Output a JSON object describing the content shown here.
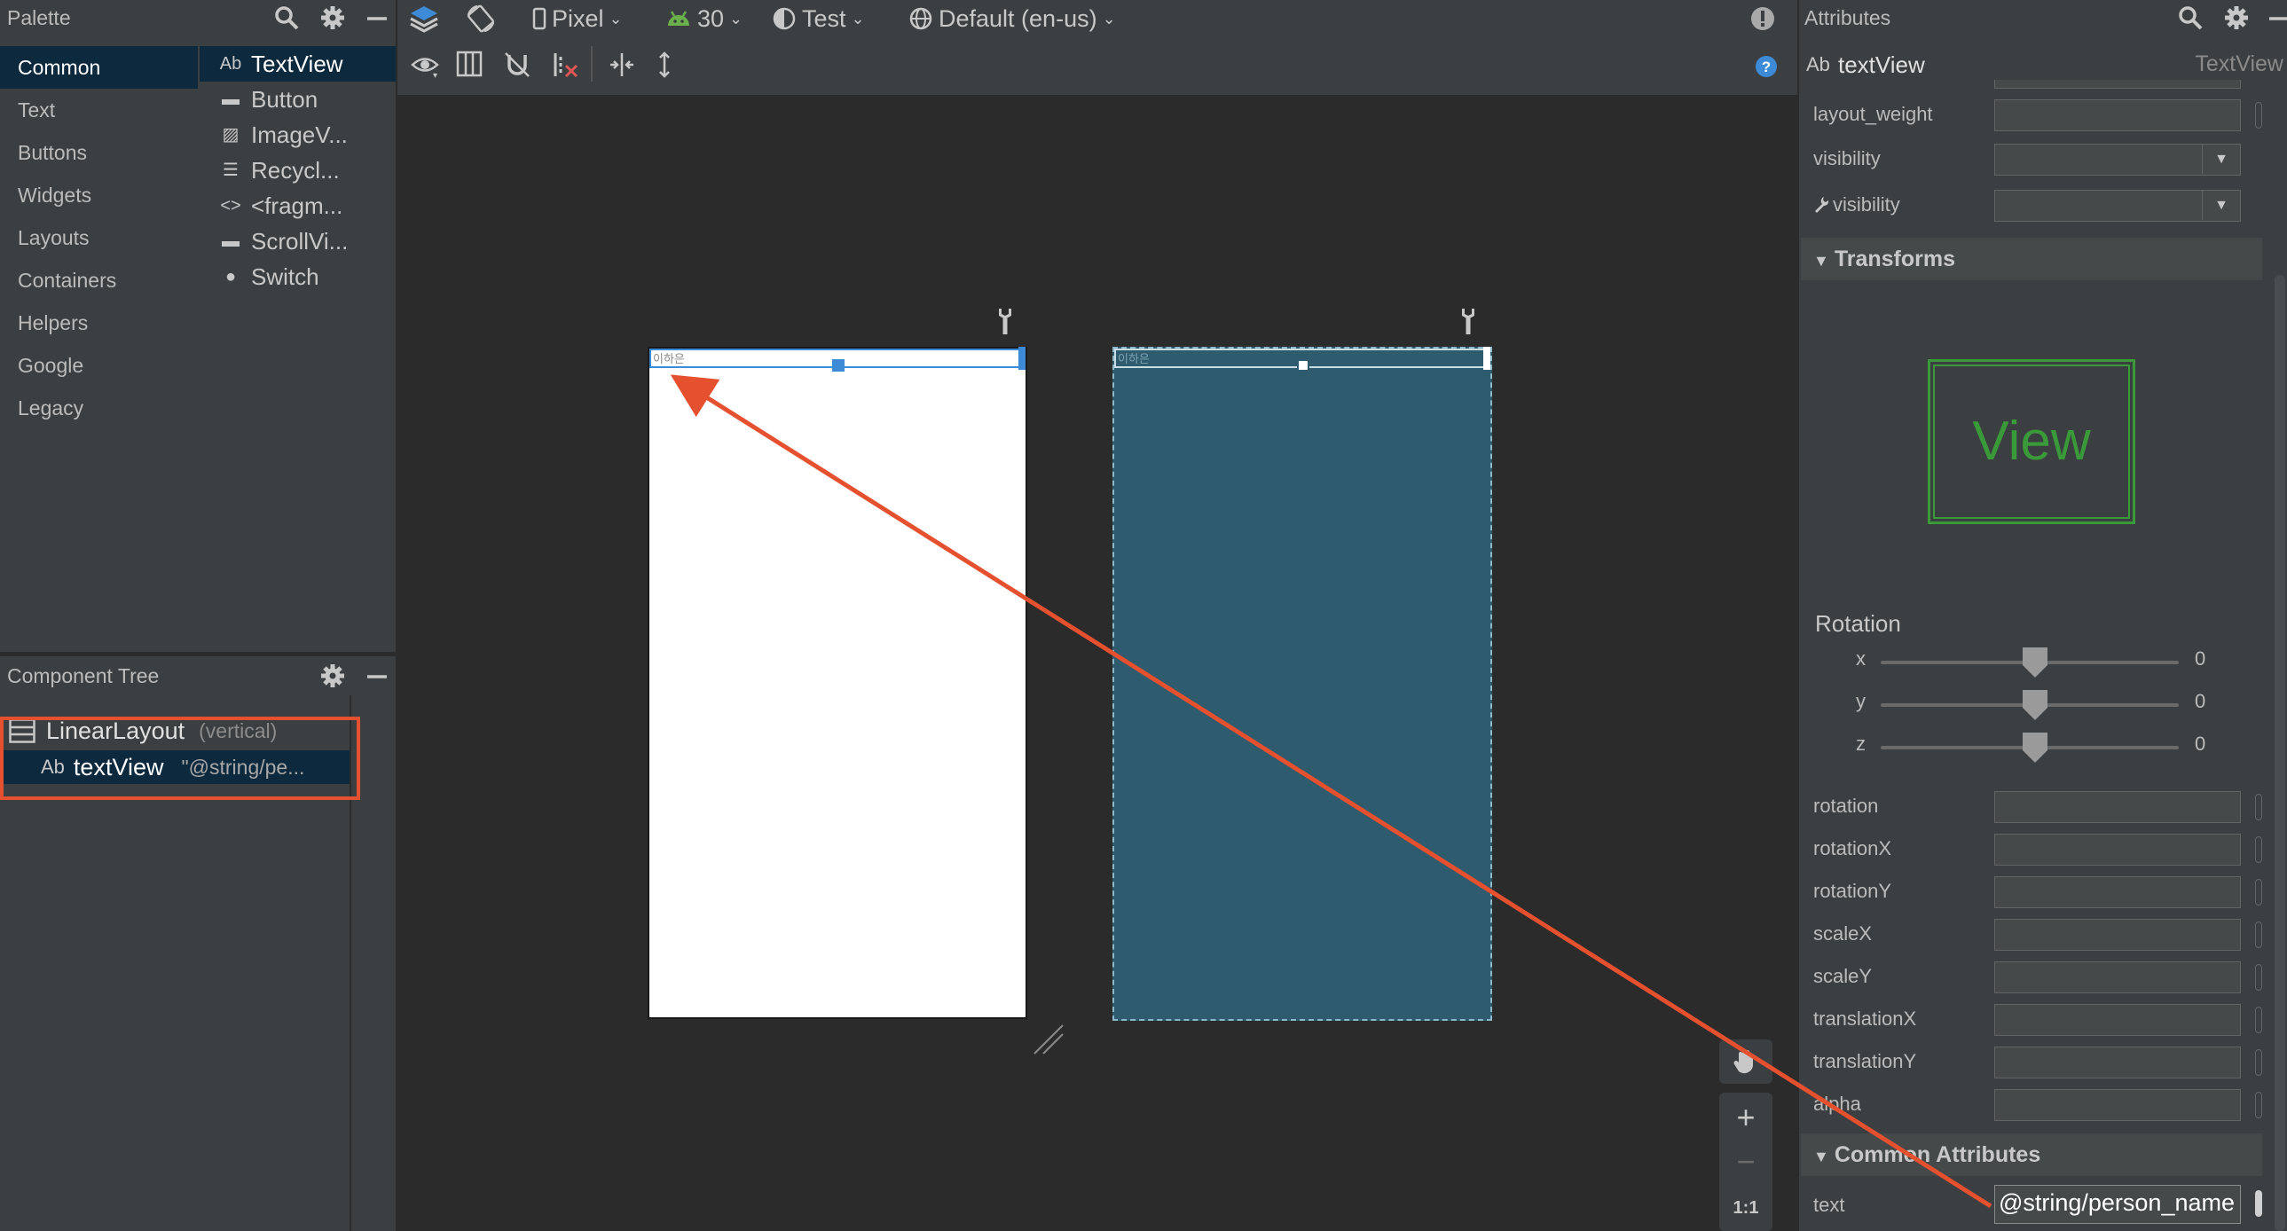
{
  "palette": {
    "title": "Palette",
    "categories": [
      "Common",
      "Text",
      "Buttons",
      "Widgets",
      "Layouts",
      "Containers",
      "Helpers",
      "Google",
      "Legacy"
    ],
    "items": [
      {
        "icon": "Ab",
        "label": "TextView"
      },
      {
        "icon": "▬",
        "label": "Button"
      },
      {
        "icon": "▨",
        "label": "ImageV..."
      },
      {
        "icon": "☰",
        "label": "Recycl..."
      },
      {
        "icon": "<>",
        "label": "<fragm..."
      },
      {
        "icon": "▬",
        "label": "ScrollVi..."
      },
      {
        "icon": "●",
        "label": "Switch"
      }
    ]
  },
  "component_tree": {
    "title": "Component Tree",
    "root": {
      "label": "LinearLayout",
      "hint": "(vertical)"
    },
    "child": {
      "prefix": "Ab",
      "label": "textView",
      "hint": "\"@string/pe..."
    }
  },
  "toolbar": {
    "device": "Pixel",
    "api": "30",
    "theme": "Test",
    "locale": "Default (en-us)"
  },
  "canvas": {
    "design_text": "이하은",
    "blueprint_text": "이하은",
    "zoom_reset": "1:1"
  },
  "attributes": {
    "title": "Attributes",
    "component_prefix": "Ab",
    "component_name": "textView",
    "component_type": "TextView",
    "rows_top": [
      "layout_weight",
      "visibility",
      "visibility"
    ],
    "transforms_title": "Transforms",
    "preview_text": "View",
    "rotation_title": "Rotation",
    "sliders": [
      {
        "axis": "x",
        "value": "0"
      },
      {
        "axis": "y",
        "value": "0"
      },
      {
        "axis": "z",
        "value": "0"
      }
    ],
    "transform_rows": [
      "rotation",
      "rotationX",
      "rotationY",
      "scaleX",
      "scaleY",
      "translationX",
      "translationY",
      "alpha"
    ],
    "common_title": "Common Attributes",
    "text_label": "text",
    "text_value": "@string/person_name"
  },
  "colors": {
    "accent_red": "#e5502f",
    "blueprint": "#2f5b6e",
    "selection": "#0d293e",
    "preview_green": "#3a9a3a"
  }
}
